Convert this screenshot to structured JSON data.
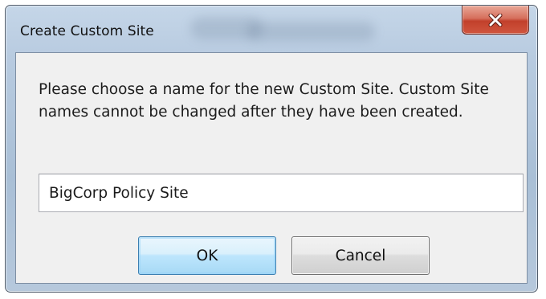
{
  "dialog": {
    "title": "Create Custom Site",
    "message": "Please choose a name for the new Custom Site.  Custom Site names cannot be changed after they have been created.",
    "name_input": {
      "value": "BigCorp Policy Site"
    },
    "buttons": {
      "ok_label": "OK",
      "cancel_label": "Cancel"
    },
    "close_icon": "close-icon"
  },
  "colors": {
    "close_button": "#c9503a",
    "ok_border": "#3c7fb1",
    "client_background": "#f0f0f0"
  }
}
